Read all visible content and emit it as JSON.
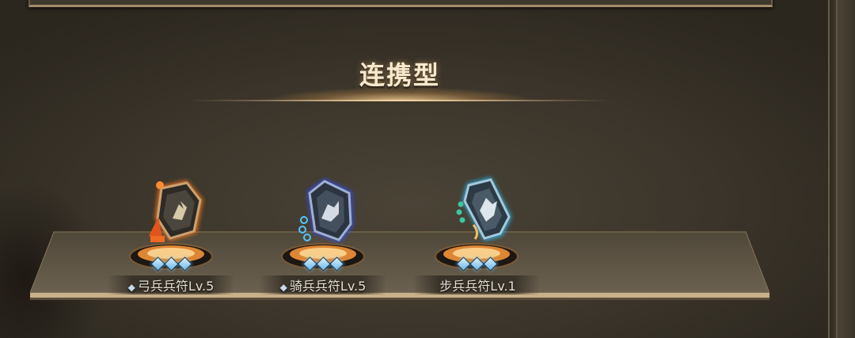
{
  "section": {
    "title": "连携型"
  },
  "items": [
    {
      "name": "弓兵兵符Lv.5",
      "prefix_mark": "◆",
      "level_pips": 3,
      "icon": "archer-tally-icon",
      "glow_color": "#ff8a2a"
    },
    {
      "name": "骑兵兵符Lv.5",
      "prefix_mark": "◆",
      "level_pips": 3,
      "icon": "cavalry-tally-icon",
      "glow_color": "#4a6cff"
    },
    {
      "name": "步兵兵符Lv.1",
      "prefix_mark": "",
      "level_pips": 3,
      "icon": "infantry-tally-icon",
      "glow_color": "#37c9ff"
    }
  ]
}
